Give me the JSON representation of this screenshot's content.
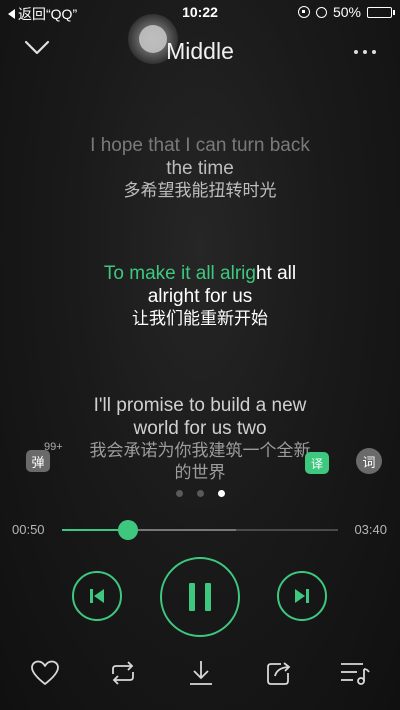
{
  "status_bar": {
    "back_app": "返回“QQ”",
    "time": "10:22",
    "battery": "50%",
    "battery_level": 0.5
  },
  "header": {
    "title": "Middle"
  },
  "lyrics": {
    "previous": {
      "en_line1": "I hope that I can turn back",
      "en_line2": "the time",
      "zh": "多希望我能扭转时光"
    },
    "current": {
      "en_sung": "To make it all alrig",
      "en_rest": "ht all",
      "en_line2": "alright for us",
      "zh": "让我们能重新开始"
    },
    "next": {
      "en_line1": "I'll promise to build a new",
      "en_line2": "world for us two",
      "zh_line1": "我会承诺为你我建筑一个全新",
      "zh_line2": "的世界"
    }
  },
  "side_buttons": {
    "danmu_label": "弹",
    "danmu_count": "99+",
    "translate_label": "译",
    "word_label": "词"
  },
  "pager": {
    "count": 3,
    "active_index": 2
  },
  "progress": {
    "elapsed": "00:50",
    "duration": "03:40",
    "played_fraction": 0.24,
    "buffered_fraction": 0.63
  },
  "colors": {
    "accent": "#3ec87f",
    "background": "#1a1a1a"
  },
  "controls": {
    "prev_icon": "skip-previous-icon",
    "play_pause_icon": "pause-icon",
    "next_icon": "skip-next-icon"
  },
  "toolbar_icons": [
    "heart-icon",
    "loop-icon",
    "download-icon",
    "share-icon",
    "playlist-icon"
  ]
}
